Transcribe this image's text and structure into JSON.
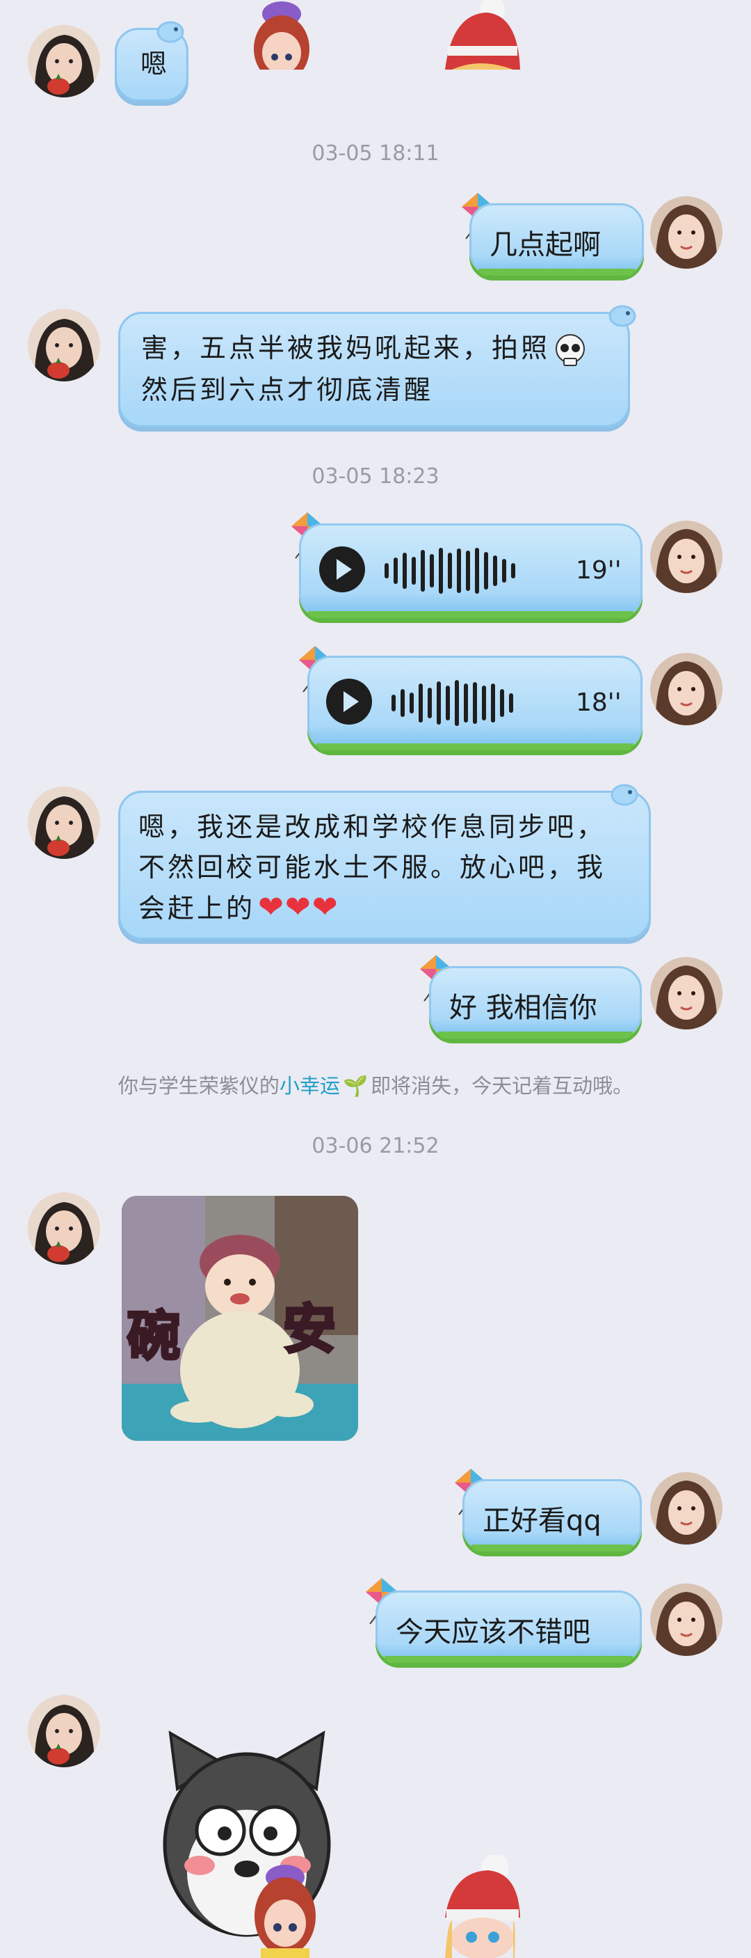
{
  "messages": {
    "m1_text": "嗯",
    "m2_text": "几点起啊",
    "m3_line1": "害，五点半被我妈吼起来，拍照",
    "m3_emoji": "skull",
    "m3_line2": "然后到六点才彻底清醒",
    "v1_duration": "19''",
    "v2_duration": "18''",
    "m4_line1": "嗯，我还是改成和学校作息同步吧，",
    "m4_line2": "不然回校可能水土不服。放心吧，我",
    "m4_line3": "会赶上的",
    "m5_text": "好 我相信你",
    "m6_text": "正好看qq",
    "m7_text": "今天应该不错吧"
  },
  "timestamps": {
    "t1": "03-05 18:11",
    "t2": "03-05 18:23",
    "t3": "03-06 21:52"
  },
  "notice": {
    "before": "你与学生荣紫仪的",
    "link": "小幸运",
    "after": "即将消失，今天记着互动哦。"
  },
  "sticker": {
    "left_char": "碗",
    "right_char": "安"
  },
  "colors": {
    "background": "#ebebf3",
    "bubble_blue": "#a8d7f8",
    "grass_green": "#6cc24a",
    "link_teal": "#1f9fc8"
  }
}
